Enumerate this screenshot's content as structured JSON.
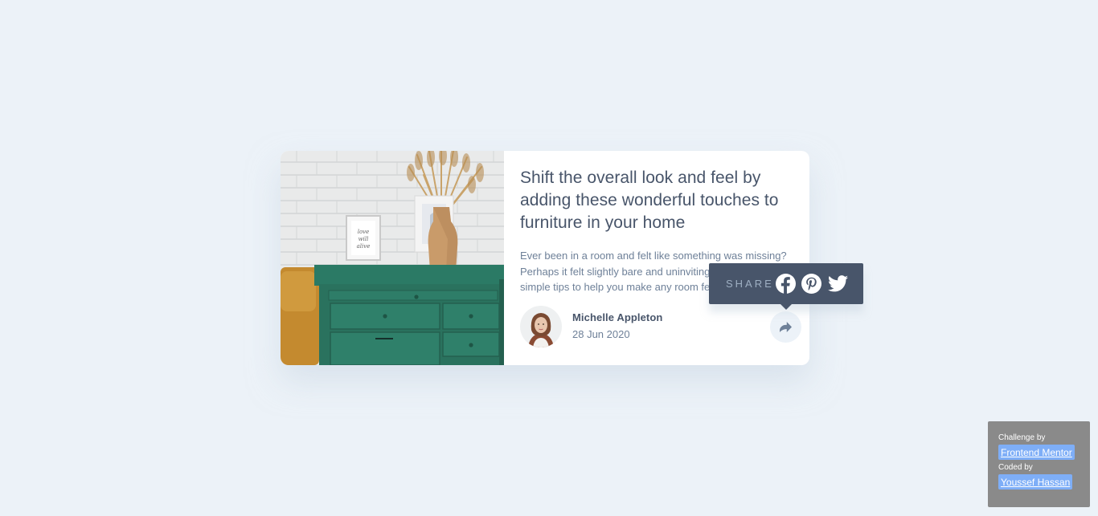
{
  "article": {
    "title": "Shift the overall look and feel by adding these wonderful touches to furniture in your home",
    "description": "Ever been in a room and felt like something was missing? Perhaps it felt slightly bare and uninviting. I’ve got some simple tips to help you make any room feel complete.",
    "image_alt": "drawers"
  },
  "author": {
    "name": "Michelle Appleton",
    "date": "28 Jun 2020",
    "avatar_alt": "michelle"
  },
  "share": {
    "label": "SHARE",
    "icons": [
      "facebook-icon",
      "pinterest-icon",
      "twitter-icon",
      "share-arrow-icon"
    ]
  },
  "attribution": {
    "challenge_label": "Challenge by",
    "challenge_link": "Frontend Mentor",
    "coded_label": "Coded by",
    "coded_link": "Youssef Hassan"
  },
  "colors": {
    "background": "#ecf2f8",
    "title": "#48556a",
    "body": "#6e8098",
    "tooltip": "#48556a",
    "share_label": "#9eafc2",
    "link_bg": "#7eaef7",
    "attribution_bg": "#8a8a8a"
  }
}
